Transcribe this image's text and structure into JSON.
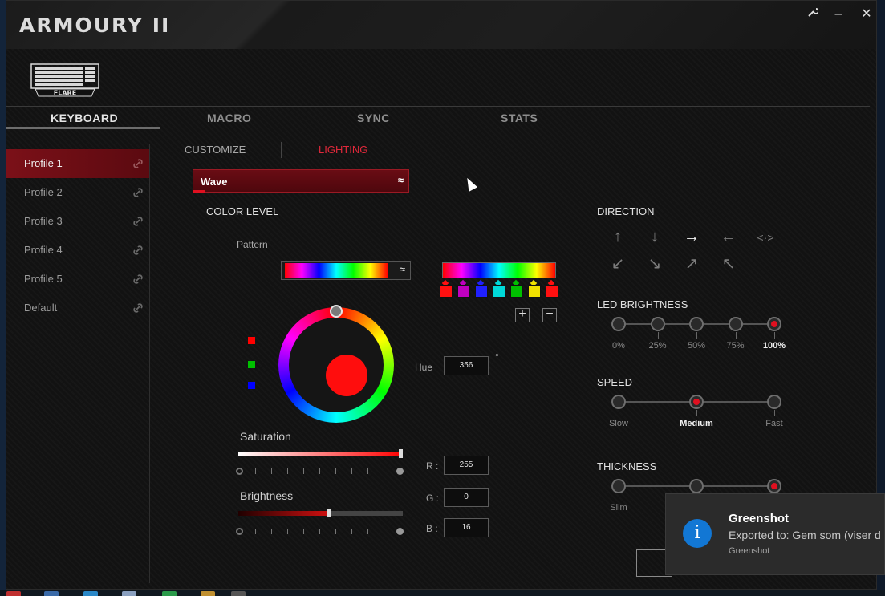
{
  "app": {
    "title": "ARMOURY II",
    "device_label": "FLARE"
  },
  "window_controls": {
    "settings_icon": "wrench-icon",
    "minimize": "–",
    "close": "✕"
  },
  "nav_tabs": [
    {
      "label": "KEYBOARD",
      "active": true
    },
    {
      "label": "MACRO",
      "active": false
    },
    {
      "label": "SYNC",
      "active": false
    },
    {
      "label": "STATS",
      "active": false
    }
  ],
  "profiles": [
    {
      "label": "Profile 1",
      "active": true
    },
    {
      "label": "Profile 2",
      "active": false
    },
    {
      "label": "Profile 3",
      "active": false
    },
    {
      "label": "Profile 4",
      "active": false
    },
    {
      "label": "Profile 5",
      "active": false
    },
    {
      "label": "Default",
      "active": false
    }
  ],
  "sub_tabs": {
    "customize": "CUSTOMIZE",
    "lighting": "LIGHTING",
    "active": "LIGHTING"
  },
  "effect": {
    "selected": "Wave",
    "chevron": "≈"
  },
  "color_level": {
    "title": "COLOR LEVEL",
    "pattern_label": "Pattern",
    "pattern_chevron": "≈",
    "swatches": [
      "#ff1010",
      "#c000c0",
      "#2020ff",
      "#00d8d8",
      "#00c000",
      "#f0e000",
      "#ff1010"
    ],
    "add": "+",
    "remove": "−",
    "hue_label": "Hue",
    "hue_value": "356",
    "degree": "°",
    "rgb_indicators": [
      "#ff0000",
      "#00c000",
      "#0000ff"
    ],
    "saturation_label": "Saturation",
    "saturation_level": 1.0,
    "brightness_label": "Brightness",
    "brightness_level": 0.55,
    "r_label": "R :",
    "r_value": "255",
    "g_label": "G :",
    "g_value": "0",
    "b_label": "B :",
    "b_value": "16",
    "accent_color": "#ff0d0d"
  },
  "direction": {
    "title": "DIRECTION",
    "row1": [
      {
        "icon": "arrow-up-icon",
        "glyph": "↑",
        "active": false
      },
      {
        "icon": "arrow-down-icon",
        "glyph": "↓",
        "active": false
      },
      {
        "icon": "arrow-right-icon",
        "glyph": "→",
        "active": true
      },
      {
        "icon": "arrow-left-icon",
        "glyph": "←",
        "active": false
      },
      {
        "icon": "arrow-in-out-icon",
        "glyph": "<·>",
        "active": false
      }
    ],
    "row2": [
      {
        "icon": "arrow-down-left-icon",
        "glyph": "↙",
        "active": false
      },
      {
        "icon": "arrow-down-right-icon",
        "glyph": "↘",
        "active": false
      },
      {
        "icon": "arrow-up-right-icon",
        "glyph": "↗",
        "active": false
      },
      {
        "icon": "arrow-up-left-icon",
        "glyph": "↖",
        "active": false
      }
    ]
  },
  "led_brightness": {
    "title": "LED BRIGHTNESS",
    "options": [
      "0%",
      "25%",
      "50%",
      "75%",
      "100%"
    ],
    "selected_index": 4
  },
  "speed": {
    "title": "SPEED",
    "options": [
      "Slow",
      "Medium",
      "Fast"
    ],
    "selected_index": 1
  },
  "thickness": {
    "title": "THICKNESS",
    "options": [
      "Slim"
    ],
    "selected_index": 2
  },
  "notification": {
    "icon": "info-icon",
    "icon_glyph": "i",
    "title": "Greenshot",
    "body": "Exported to: Gem som (viser d",
    "source": "Greenshot",
    "accent": "#1277d4"
  }
}
